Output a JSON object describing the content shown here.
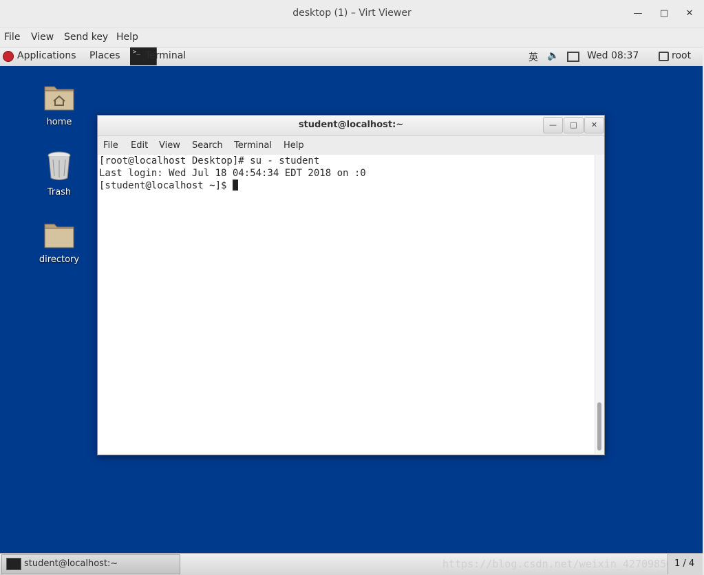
{
  "viewer": {
    "title": "desktop (1) – Virt Viewer",
    "menu": [
      "File",
      "View",
      "Send key",
      "Help"
    ]
  },
  "guest_panel": {
    "applications": "Applications",
    "places": "Places",
    "terminal_task": "Terminal",
    "input_method": "英",
    "datetime": "Wed 08:37",
    "user": "root"
  },
  "desktop_icons": [
    {
      "label": "home",
      "icon": "home-folder-icon"
    },
    {
      "label": "Trash",
      "icon": "trash-icon"
    },
    {
      "label": "directory",
      "icon": "folder-icon"
    }
  ],
  "terminal": {
    "title": "student@localhost:~",
    "menu": [
      "File",
      "Edit",
      "View",
      "Search",
      "Terminal",
      "Help"
    ],
    "lines": [
      "[root@localhost Desktop]# su - student",
      "Last login: Wed Jul 18 04:54:34 EDT 2018 on :0",
      "[student@localhost ~]$ "
    ]
  },
  "taskbar": {
    "window_label": "student@localhost:~",
    "watermark": "https://blog.csdn.net/weixin_42709850",
    "workspace": "1 / 4"
  },
  "colors": {
    "desktop_bg": "#003a8c",
    "panel_bg": "#e6e6e6"
  }
}
